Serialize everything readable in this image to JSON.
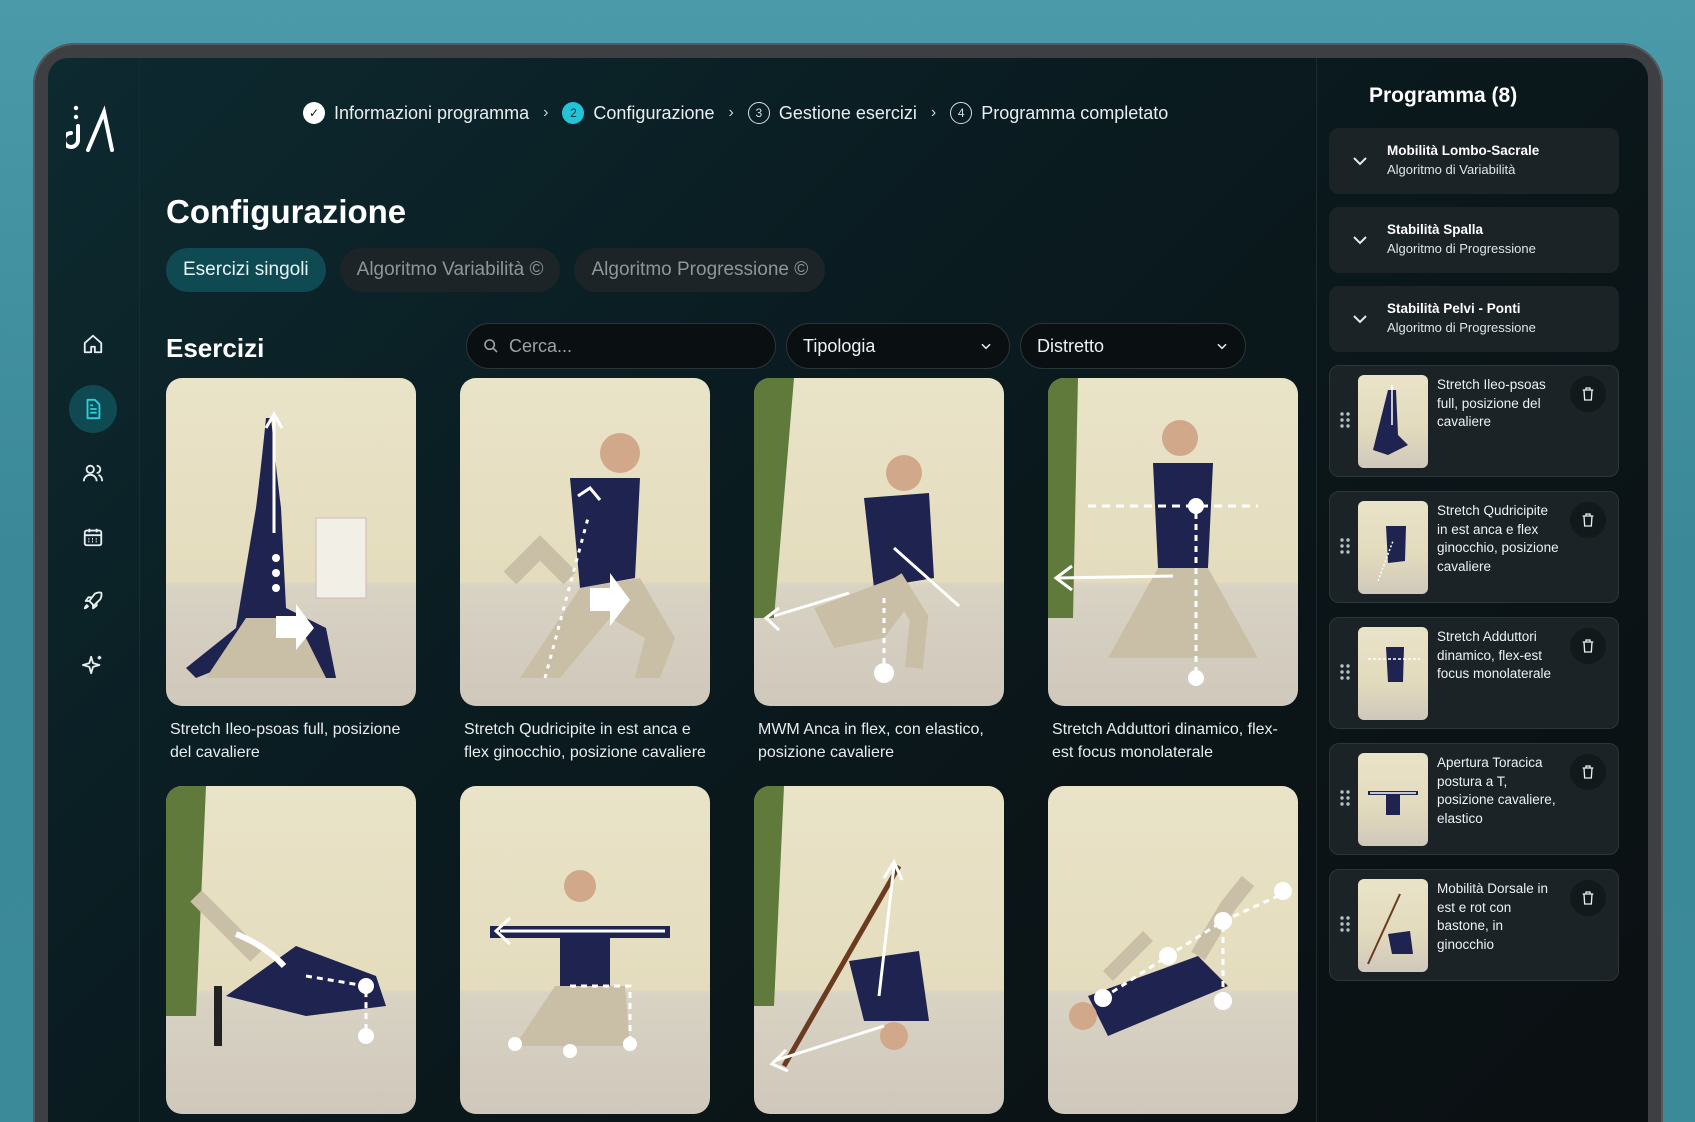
{
  "stepper": {
    "steps": [
      {
        "label": "Informazioni programma",
        "state": "done",
        "badge": "✓"
      },
      {
        "label": "Configurazione",
        "state": "current",
        "badge": "2"
      },
      {
        "label": "Gestione esercizi",
        "state": "todo",
        "badge": "3"
      },
      {
        "label": "Programma completato",
        "state": "todo",
        "badge": "4"
      }
    ]
  },
  "page": {
    "title": "Configurazione",
    "section_title": "Esercizi"
  },
  "tabs": [
    "Esercizi singoli",
    "Algoritmo Variabilità ©",
    "Algoritmo Progressione ©"
  ],
  "filters": {
    "search_placeholder": "Cerca...",
    "tipologia": "Tipologia",
    "distretto": "Distretto"
  },
  "exercises": [
    "Stretch Ileo-psoas full, posizione del cavaliere",
    "Stretch Qudricipite in est anca e flex ginocchio, posizione cavaliere",
    "MWM Anca in flex, con elastico, posizione cavaliere",
    "Stretch Adduttori dinamico, flex-est focus monolaterale"
  ],
  "panel": {
    "title": "Programma (8)",
    "groups": [
      {
        "title": "Mobilità Lombo-Sacrale",
        "subtitle": "Algoritmo di Variabilità"
      },
      {
        "title": "Stabilità Spalla",
        "subtitle": "Algoritmo di Progressione"
      },
      {
        "title": "Stabilità Pelvi - Ponti",
        "subtitle": "Algoritmo di Progressione"
      }
    ],
    "items": [
      "Stretch Ileo-psoas full, posizione del cavaliere",
      "Stretch Qudricipite in est anca e flex ginocchio, posizione cavaliere",
      "Stretch Adduttori dinamico, flex-est focus monolaterale",
      "Apertura Toracica postura a T, posizione cavaliere, elastico",
      "Mobilità Dorsale in est e rot con bastone, in ginocchio"
    ]
  },
  "colors": {
    "accent": "#23c4d8",
    "active_bg": "#0f4a52",
    "panel_card": "#1b2326"
  },
  "icons": [
    "home-icon",
    "document-icon",
    "users-icon",
    "calendar-icon",
    "rocket-icon",
    "sparkle-icon",
    "chevron-down-icon",
    "search-icon",
    "drag-handle-icon",
    "trash-icon"
  ]
}
